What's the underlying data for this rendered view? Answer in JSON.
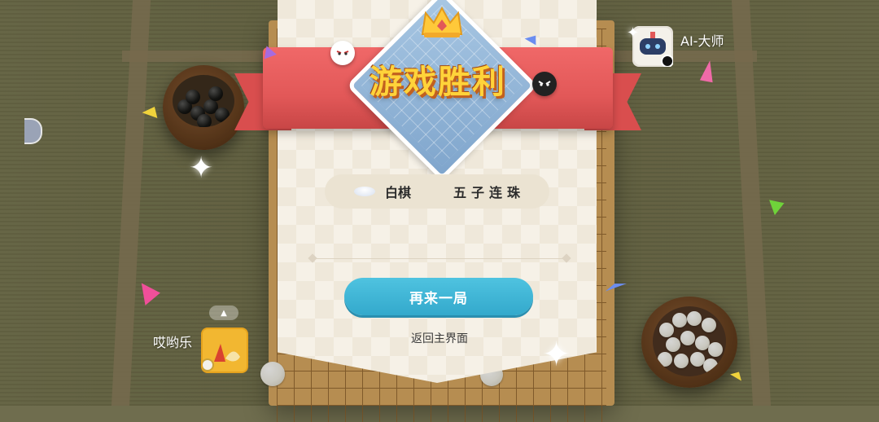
{
  "title": "游戏胜利",
  "result": {
    "winner": "白棋",
    "reason": "五子连珠"
  },
  "buttons": {
    "play_again": "再来一局",
    "return_home": "返回主界面"
  },
  "players": {
    "opponent": {
      "name": "AI-大师",
      "stone": "black"
    },
    "self": {
      "name": "哎哟乐",
      "stone": "white"
    }
  },
  "icons": {
    "crown": "crown-icon",
    "win_stone": "white-stone-icon",
    "mascot_white": "white-stone-mascot-icon",
    "mascot_black": "black-stone-mascot-icon",
    "collapse": "chevron-up-icon"
  },
  "colors": {
    "ribbon": "#e25858",
    "title": "#ffd33a",
    "button": "#33a9cc",
    "card": "#f6f1e7"
  }
}
